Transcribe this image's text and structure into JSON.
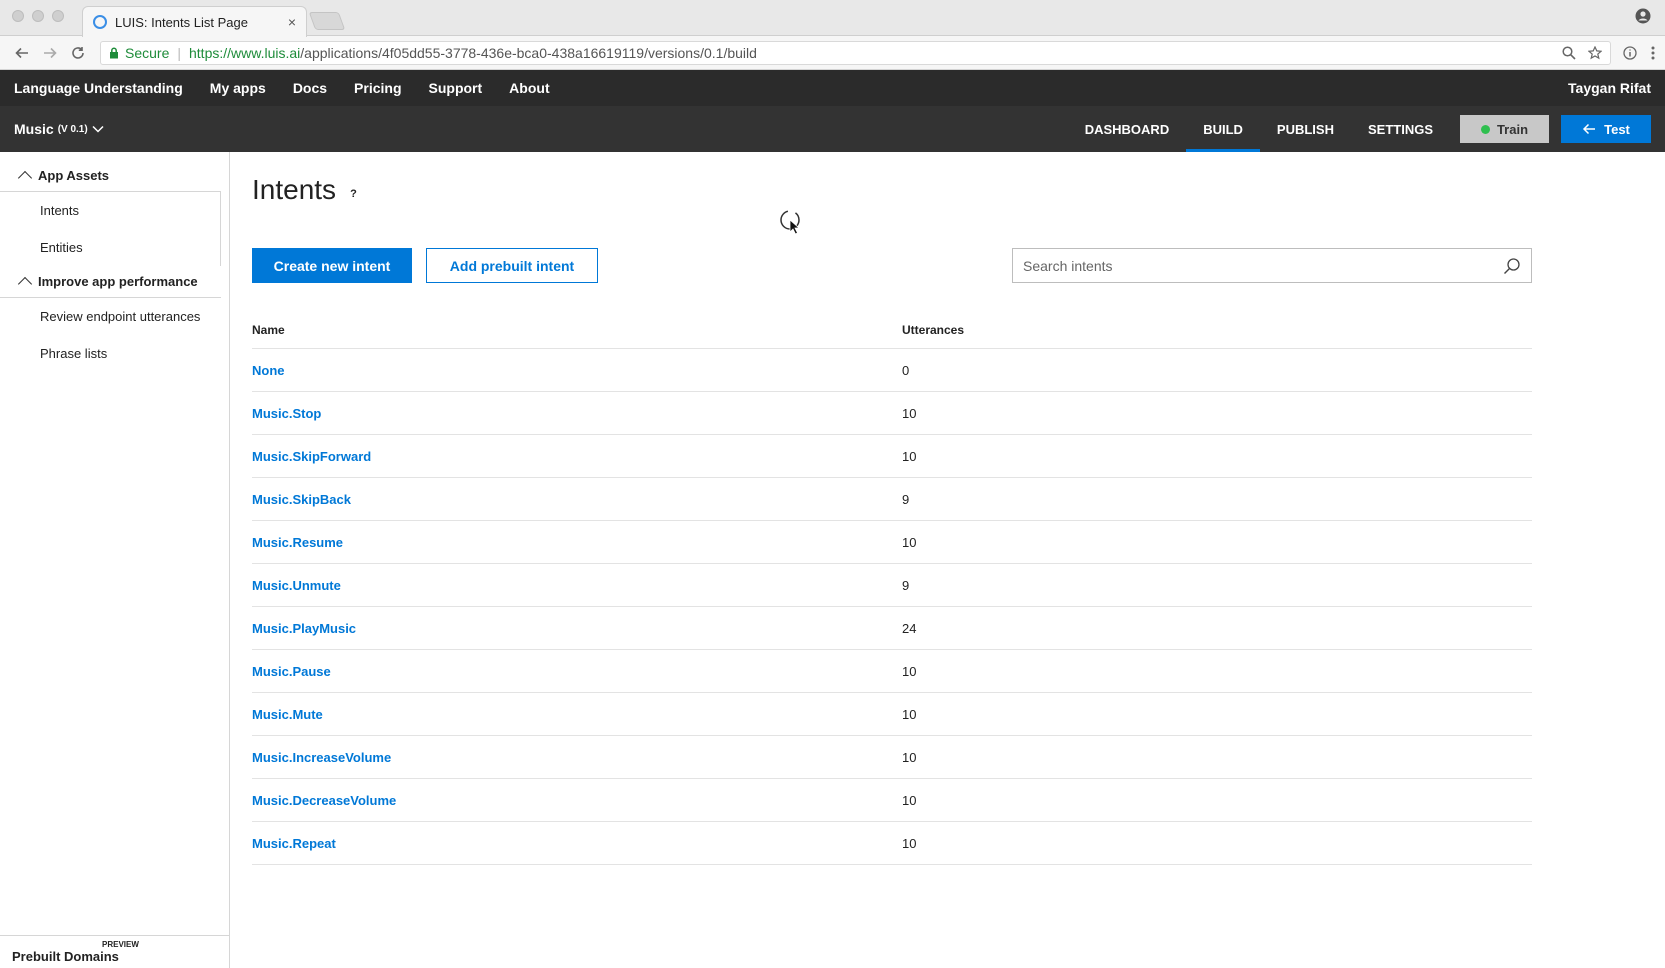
{
  "browser": {
    "tab_title": "LUIS: Intents List Page",
    "close_glyph": "×",
    "secure_label": "Secure",
    "url_host": "https://www.luis.ai",
    "url_path": "/applications/4f05dd55-3778-436e-bca0-438a16619119/versions/0.1/build"
  },
  "topnav": {
    "items": [
      "Language Understanding",
      "My apps",
      "Docs",
      "Pricing",
      "Support",
      "About"
    ],
    "user": "Taygan Rifat"
  },
  "subnav": {
    "app_name": "Music",
    "app_version": "(V 0.1)",
    "tabs": [
      "DASHBOARD",
      "BUILD",
      "PUBLISH",
      "SETTINGS"
    ],
    "active_tab": "BUILD",
    "train_label": "Train",
    "test_label": "Test",
    "train_status_color": "#2fbf4f",
    "accent_color": "#0078d7"
  },
  "sidebar": {
    "sections": [
      {
        "label": "App Assets",
        "items": [
          "Intents",
          "Entities"
        ]
      },
      {
        "label": "Improve app performance",
        "items": [
          "Review endpoint utterances",
          "Phrase lists"
        ]
      }
    ],
    "preview_badge": "PREVIEW",
    "prebuilt_label": "Prebuilt Domains"
  },
  "main": {
    "title": "Intents",
    "help": "?",
    "create_button": "Create new intent",
    "prebuilt_button": "Add prebuilt intent",
    "search_placeholder": "Search intents",
    "table": {
      "headers": [
        "Name",
        "Utterances"
      ],
      "rows": [
        {
          "name": "None",
          "utterances": "0"
        },
        {
          "name": "Music.Stop",
          "utterances": "10"
        },
        {
          "name": "Music.SkipForward",
          "utterances": "10"
        },
        {
          "name": "Music.SkipBack",
          "utterances": "9"
        },
        {
          "name": "Music.Resume",
          "utterances": "10"
        },
        {
          "name": "Music.Unmute",
          "utterances": "9"
        },
        {
          "name": "Music.PlayMusic",
          "utterances": "24"
        },
        {
          "name": "Music.Pause",
          "utterances": "10"
        },
        {
          "name": "Music.Mute",
          "utterances": "10"
        },
        {
          "name": "Music.IncreaseVolume",
          "utterances": "10"
        },
        {
          "name": "Music.DecreaseVolume",
          "utterances": "10"
        },
        {
          "name": "Music.Repeat",
          "utterances": "10"
        }
      ]
    }
  }
}
